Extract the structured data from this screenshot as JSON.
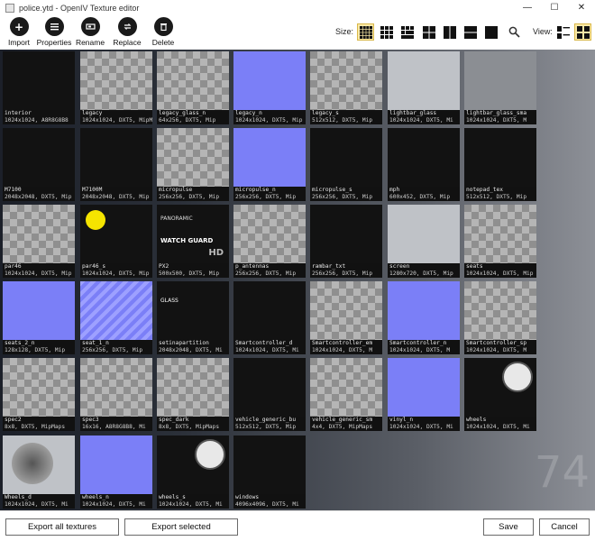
{
  "window": {
    "title": "police.ytd - OpenIV Texture editor"
  },
  "controls": {
    "minimize": "—",
    "maximize": "☐",
    "close": "✕"
  },
  "toolbar": {
    "import": "Import",
    "properties": "Properties",
    "rename": "Rename",
    "replace": "Replace",
    "delete": "Delete",
    "size_label": "Size:",
    "view_label": "View:"
  },
  "gallery": {
    "count_watermark": "74",
    "textures": [
      {
        "name": "interior",
        "info": "1024x1024, A8R8G8B8"
      },
      {
        "name": "legacy",
        "info": "1024x1024, DXT5, MipM"
      },
      {
        "name": "legacy_glass_n",
        "info": "64x256, DXT5, Mip"
      },
      {
        "name": "legacy_n",
        "info": "1024x1024, DXT5, Mip"
      },
      {
        "name": "legacy_s",
        "info": "512x512, DXT5, Mip"
      },
      {
        "name": "lightbar_glass",
        "info": "1024x1024, DXT5, Mi"
      },
      {
        "name": "lightbar_glass_sma",
        "info": "1024x1024, DXT5, M"
      },
      {
        "name": "M7100",
        "info": "2048x2048, DXT5, Mip"
      },
      {
        "name": "M7100M",
        "info": "2048x2048, DXT5, Mip"
      },
      {
        "name": "micropulse",
        "info": "256x256, DXT5, Mip"
      },
      {
        "name": "micropulse_n",
        "info": "256x256, DXT5, Mip"
      },
      {
        "name": "micropulse_s",
        "info": "256x256, DXT5, Mip"
      },
      {
        "name": "mph",
        "info": "600x452, DXT5, Mip"
      },
      {
        "name": "notepad_tex",
        "info": "512x512, DXT5, Mip"
      },
      {
        "name": "par46",
        "info": "1024x1024, DXT5, Mip"
      },
      {
        "name": "par46_s",
        "info": "1024x1024, DXT5, Mip"
      },
      {
        "name": "PX2",
        "info": "500x500, DXT5, Mip"
      },
      {
        "name": "p_antennas",
        "info": "256x256, DXT5, Mip"
      },
      {
        "name": "rambar_txt",
        "info": "256x256, DXT5, Mip"
      },
      {
        "name": "screen",
        "info": "1280x720, DXT5, Mip"
      },
      {
        "name": "seats",
        "info": "1024x1024, DXT5, Mip"
      },
      {
        "name": "seats_2_n",
        "info": "128x128, DXT5, Mip"
      },
      {
        "name": "seat_1_n",
        "info": "256x256, DXT5, Mip"
      },
      {
        "name": "setinapartition",
        "info": "2048x2048, DXT5, Mi"
      },
      {
        "name": "Smartcontroller_d",
        "info": "1024x1024, DXT5, Mi"
      },
      {
        "name": "Smartcontroller_em",
        "info": "1024x1024, DXT5, M"
      },
      {
        "name": "Smartcontroller_n",
        "info": "1024x1024, DXT5, M"
      },
      {
        "name": "Smartcontroller_sp",
        "info": "1024x1024, DXT5, M"
      },
      {
        "name": "spec2",
        "info": "8x8, DXT5, MipMaps"
      },
      {
        "name": "spec3",
        "info": "16x16, A8R8G8B8, Mi"
      },
      {
        "name": "spec_dark",
        "info": "8x8, DXT5, MipMaps"
      },
      {
        "name": "vehicle_generic_bu",
        "info": "512x512, DXT5, Mip"
      },
      {
        "name": "vehicle_generic_sm",
        "info": "4x4, DXT5, MipMaps"
      },
      {
        "name": "vinyl_n",
        "info": "1024x1024, DXT5, Mi"
      },
      {
        "name": "wheels",
        "info": "1024x1024, DXT5, Mi"
      },
      {
        "name": "Wheels_d",
        "info": "1024x1024, DXT5, Mi"
      },
      {
        "name": "wheels_n",
        "info": "1024x1024, DXT5, Mi"
      },
      {
        "name": "wheels_s",
        "info": "1024x1024, DXT5, Mi"
      },
      {
        "name": "windows",
        "info": "4096x4096, DXT5, Mi"
      }
    ]
  },
  "thumb_text": {
    "px2_top": "PANORAMIC",
    "px2_brand": "WATCH GUARD",
    "px2_hd": "HD",
    "setina_glass": "GLASS"
  },
  "bottom": {
    "export_all": "Export all textures",
    "export_selected": "Export selected",
    "save": "Save",
    "cancel": "Cancel"
  },
  "colors": {
    "selected_view_bg": "#fbe9a6",
    "normal_map": "#7b7ff7",
    "caption_bg": "#0f0f0f"
  }
}
